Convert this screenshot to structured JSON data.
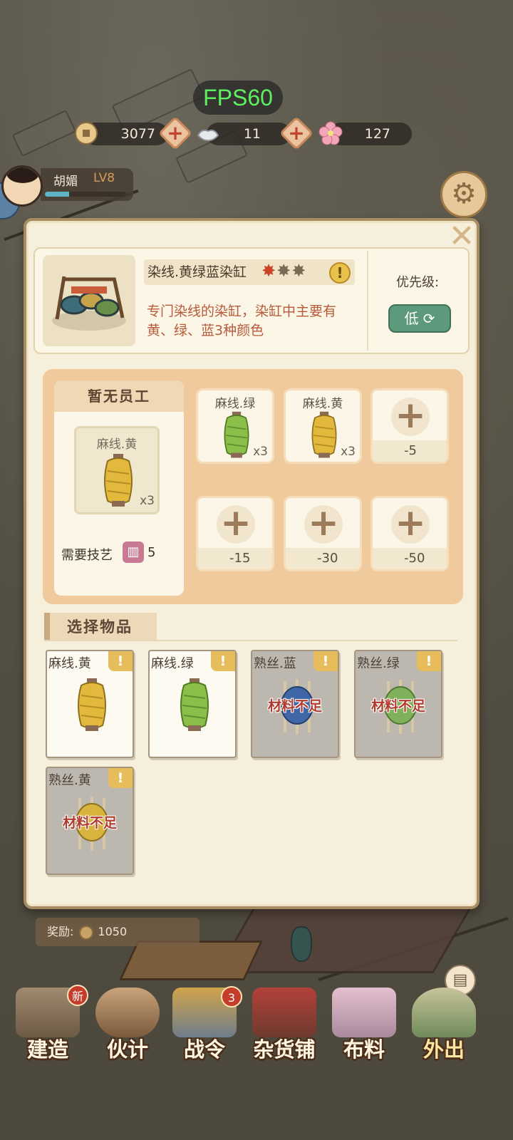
{
  "hud": {
    "fps": "FPS60",
    "copper": "3077",
    "silver": "11",
    "flower": "127"
  },
  "player": {
    "name": "胡媚",
    "level": "LV8",
    "xp_fraction": 0.3
  },
  "building": {
    "name": "染线.黄绿蓝染缸",
    "stars_lit": 1,
    "stars_total": 3,
    "description": "专门染线的染缸，染缸中主要有黄、绿、蓝3种颜色",
    "priority_label": "优先级:",
    "priority_value": "低"
  },
  "staff": {
    "header": "暂无员工",
    "item_label": "麻线.黄",
    "item_qty": "x3",
    "skill_label": "需要技艺",
    "skill_value": "5"
  },
  "slots": [
    {
      "label": "麻线.绿",
      "qty": "x3",
      "color": "#8cbf4a"
    },
    {
      "label": "麻线.黄",
      "qty": "x3",
      "color": "#e2b93c"
    },
    {
      "cost": "-5"
    },
    {
      "cost": "-15"
    },
    {
      "cost": "-30"
    },
    {
      "cost": "-50"
    }
  ],
  "selection": {
    "title": "选择物品",
    "items": [
      {
        "name": "麻线.黄",
        "status": "",
        "color": "#e2b93c"
      },
      {
        "name": "麻线.绿",
        "status": "",
        "color": "#8cbf4a"
      },
      {
        "name": "熟丝.蓝",
        "status": "材料不足",
        "color": "#3f67a8"
      },
      {
        "name": "熟丝.绿",
        "status": "材料不足",
        "color": "#7fb05a"
      },
      {
        "name": "熟丝.黄",
        "status": "材料不足",
        "color": "#d8b33e"
      }
    ]
  },
  "reward": {
    "label": "奖励:",
    "value": "1050"
  },
  "nav": [
    {
      "label": "建造",
      "badge": "新"
    },
    {
      "label": "伙计",
      "badge": ""
    },
    {
      "label": "战令",
      "badge": "3"
    },
    {
      "label": "杂货铺",
      "badge": ""
    },
    {
      "label": "布料",
      "badge": ""
    },
    {
      "label": "外出",
      "badge": ""
    }
  ],
  "colors": {
    "panel_bg": "#f6efdc",
    "accent_red": "#c8452a",
    "priority_green": "#5d9a7b",
    "craft_bg": "#f0c99c"
  }
}
